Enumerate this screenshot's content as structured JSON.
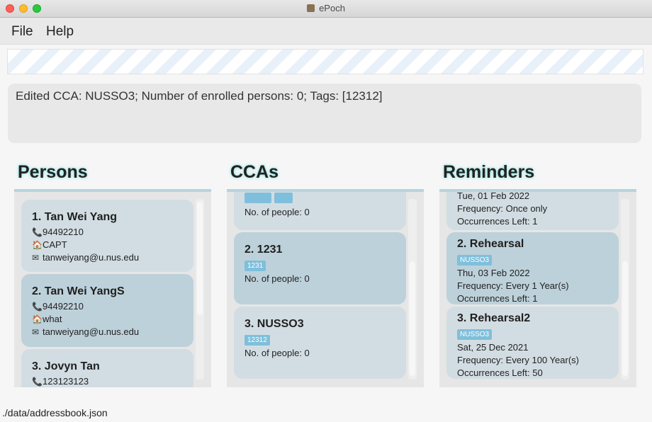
{
  "window": {
    "title": "ePoch"
  },
  "menubar": {
    "file": "File",
    "help": "Help"
  },
  "result": {
    "text": "Edited CCA: NUSSO3; Number of enrolled persons: 0; Tags: [12312]"
  },
  "persons": {
    "heading": "Persons",
    "cards": [
      {
        "title": "1.  Tan Wei Yang",
        "phone": "94492210",
        "address": "CAPT",
        "email": "tanweiyang@u.nus.edu"
      },
      {
        "title": "2.  Tan Wei YangS",
        "phone": "94492210",
        "address": "what",
        "email": "tanweiyang@u.nus.edu"
      },
      {
        "title": "3.  Jovyn Tan",
        "phone": "123123123"
      }
    ]
  },
  "ccas": {
    "heading": "CCAs",
    "partial": {
      "people": "No. of people: 0"
    },
    "cards": [
      {
        "title": "2.  1231",
        "tag": "1231",
        "people": "No. of people: 0"
      },
      {
        "title": "3.  NUSSO3",
        "tag": "12312",
        "people": "No. of people: 0"
      }
    ]
  },
  "reminders": {
    "heading": "Reminders",
    "partial": {
      "date": "Tue, 01 Feb 2022",
      "frequency": "Frequency: Once only",
      "occurrences": "Occurrences Left: 1"
    },
    "cards": [
      {
        "title": "2.  Rehearsal",
        "tag": "NUSSO3",
        "date": "Thu, 03 Feb 2022",
        "frequency": "Frequency: Every 1 Year(s)",
        "occurrences": "Occurrences Left: 1"
      },
      {
        "title": "3.  Rehearsal2",
        "tag": "NUSSO3",
        "date": "Sat, 25 Dec 2021",
        "frequency": "Frequency: Every 100 Year(s)",
        "occurrences": "Occurrences Left: 50"
      }
    ]
  },
  "statusbar": {
    "path": "./data/addressbook.json"
  },
  "icons": {
    "phone": "phone-icon",
    "address": "house-icon",
    "email": "email-icon"
  }
}
